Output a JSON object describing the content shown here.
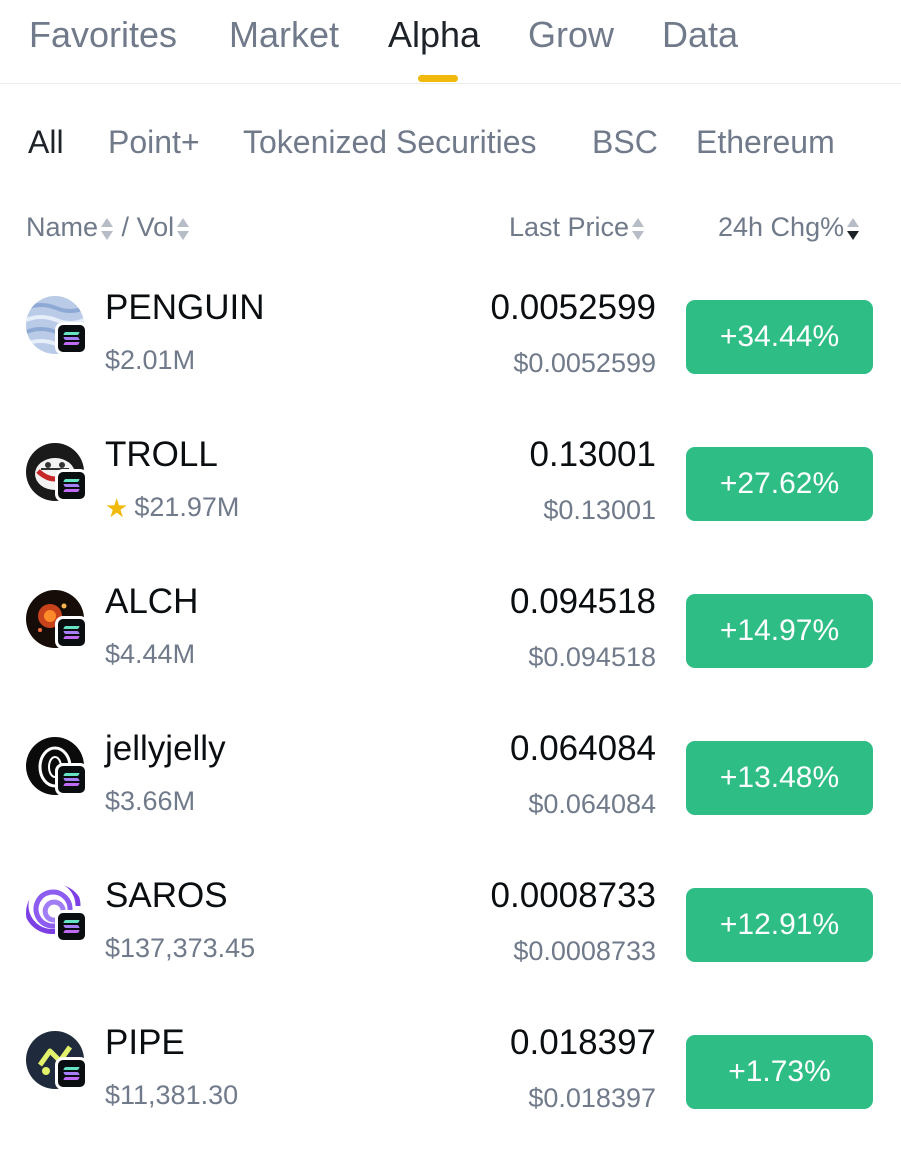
{
  "top_tabs": [
    {
      "label": "Favorites"
    },
    {
      "label": "Market"
    },
    {
      "label": "Alpha"
    },
    {
      "label": "Grow"
    },
    {
      "label": "Data"
    }
  ],
  "active_top_tab": "Alpha",
  "sub_tabs": [
    {
      "label": "All"
    },
    {
      "label": "Point+"
    },
    {
      "label": "Tokenized Securities"
    },
    {
      "label": "BSC"
    },
    {
      "label": "Ethereum"
    }
  ],
  "active_sub_tab": "All",
  "columns": {
    "name": "Name",
    "separator": "/",
    "vol": "Vol",
    "last_price": "Last Price",
    "change": "24h Chg%"
  },
  "sort": {
    "column": "24h Chg%",
    "direction": "descending"
  },
  "colors": {
    "accent": "#f0b90b",
    "positive": "#2ebd85",
    "text_primary": "#0b0e11",
    "text_secondary": "#707a8a"
  },
  "tokens": [
    {
      "name": "PENGUIN",
      "vol": "$2.01M",
      "price": "0.0052599",
      "usd": "$0.0052599",
      "change": "+34.44%",
      "favorite": false,
      "logo": "penguin-logo-icon",
      "chain": "solana-icon"
    },
    {
      "name": "TROLL",
      "vol": "$21.97M",
      "price": "0.13001",
      "usd": "$0.13001",
      "change": "+27.62%",
      "favorite": true,
      "logo": "troll-logo-icon",
      "chain": "solana-icon"
    },
    {
      "name": "ALCH",
      "vol": "$4.44M",
      "price": "0.094518",
      "usd": "$0.094518",
      "change": "+14.97%",
      "favorite": false,
      "logo": "alch-logo-icon",
      "chain": "solana-icon"
    },
    {
      "name": "jellyjelly",
      "vol": "$3.66M",
      "price": "0.064084",
      "usd": "$0.064084",
      "change": "+13.48%",
      "favorite": false,
      "logo": "jellyjelly-logo-icon",
      "chain": "solana-icon"
    },
    {
      "name": "SAROS",
      "vol": "$137,373.45",
      "price": "0.0008733",
      "usd": "$0.0008733",
      "change": "+12.91%",
      "favorite": false,
      "logo": "saros-logo-icon",
      "chain": "solana-icon"
    },
    {
      "name": "PIPE",
      "vol": "$11,381.30",
      "price": "0.018397",
      "usd": "$0.018397",
      "change": "+1.73%",
      "favorite": false,
      "logo": "pipe-logo-icon",
      "chain": "solana-icon"
    }
  ]
}
